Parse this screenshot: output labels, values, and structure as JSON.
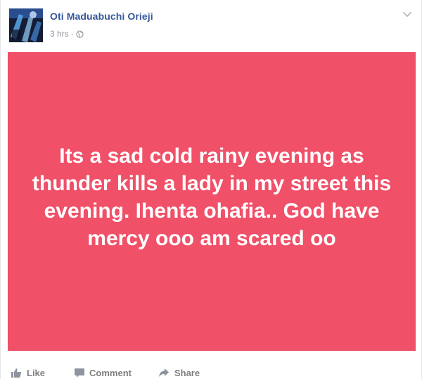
{
  "post": {
    "author_name": "Oti Maduabuchi Orieji",
    "timestamp": "3 hrs",
    "separator": "·",
    "privacy_icon": "globe-icon",
    "menu_icon": "chevron-down-icon",
    "status_text": "Its a sad cold rainy evening as thunder kills a lady in my street this evening. Ihenta ohafia.. God have mercy ooo am scared oo",
    "background_color": "#f05068"
  },
  "actions": {
    "like_label": "Like",
    "comment_label": "Comment",
    "share_label": "Share"
  }
}
